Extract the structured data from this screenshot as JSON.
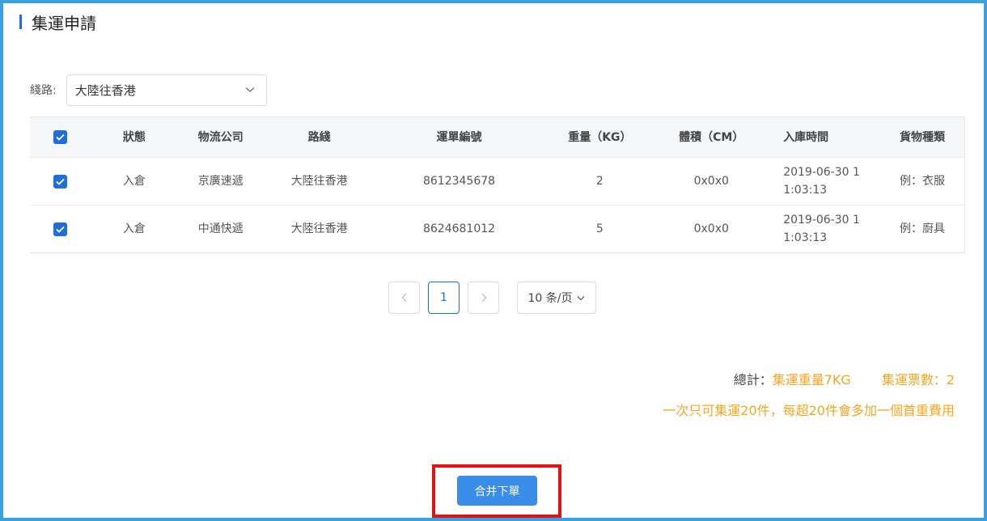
{
  "page": {
    "title": "集運申請"
  },
  "route": {
    "label": "綫路:",
    "selected": "大陸往香港"
  },
  "table": {
    "headers": [
      "狀態",
      "物流公司",
      "路綫",
      "運單編號",
      "重量（KG）",
      "體積（CM）",
      "入庫時間",
      "貨物種類"
    ],
    "rows": [
      {
        "status": "入倉",
        "company": "京廣速遞",
        "route": "大陸往香港",
        "waybill": "8612345678",
        "weight": "2",
        "volume": "0x0x0",
        "time_line1": "2019-06-30 1",
        "time_line2": "1:03:13",
        "type": "例：衣服"
      },
      {
        "status": "入倉",
        "company": "中通快遞",
        "route": "大陸往香港",
        "waybill": "8624681012",
        "weight": "5",
        "volume": "0x0x0",
        "time_line1": "2019-06-30 1",
        "time_line2": "1:03:13",
        "type": "例：廚具"
      }
    ]
  },
  "pagination": {
    "current": "1",
    "page_size": "10 条/页"
  },
  "summary": {
    "label": "總計：",
    "weight": "集運重量7KG",
    "count": "集運票數：2",
    "note": "一次只可集運20件，每超20件會多加一個首重費用"
  },
  "submit": {
    "label": "合并下單"
  },
  "colors": {
    "accent": "#1f6fd6",
    "warning": "#f5a524",
    "highlight": "#e51010"
  }
}
